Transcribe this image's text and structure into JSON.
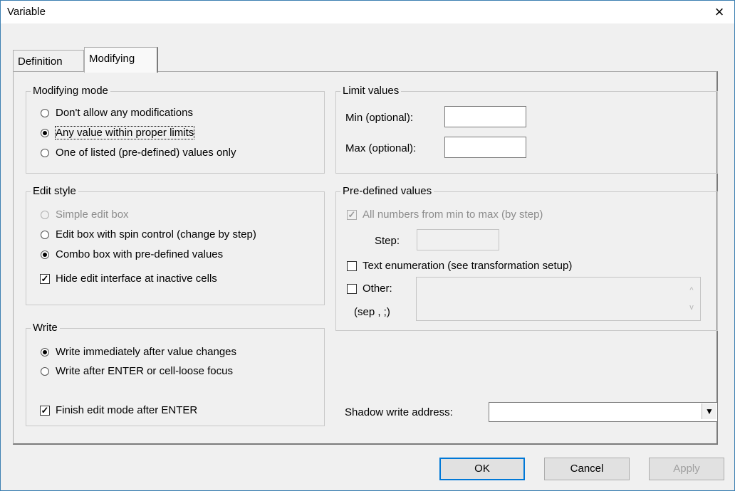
{
  "window": {
    "title": "Variable",
    "close_glyph": "×"
  },
  "tabs": [
    {
      "label": "Definition",
      "active": false
    },
    {
      "label": "Modifying",
      "active": true
    }
  ],
  "modifying_mode": {
    "title": "Modifying mode",
    "options": [
      {
        "label": "Don't allow any modifications",
        "checked": false
      },
      {
        "label": "Any value within proper limits",
        "checked": true
      },
      {
        "label": "One of listed (pre-defined) values only",
        "checked": false
      }
    ]
  },
  "limit_values": {
    "title": "Limit values",
    "min_label": "Min (optional):",
    "max_label": "Max (optional):",
    "min_value": "",
    "max_value": ""
  },
  "edit_style": {
    "title": "Edit style",
    "options": [
      {
        "label": "Simple edit box",
        "checked": false,
        "disabled": true
      },
      {
        "label": "Edit box with spin control (change by step)",
        "checked": false
      },
      {
        "label": "Combo box with pre-defined values",
        "checked": true
      }
    ],
    "hide_label": "Hide edit interface at inactive cells",
    "hide_checked": true
  },
  "predefined": {
    "title": "Pre-defined values",
    "all_numbers_label": "All numbers from min to max (by step)",
    "all_numbers_checked": true,
    "step_label": "Step:",
    "step_value": "",
    "text_enum_label": "Text enumeration (see transformation setup)",
    "text_enum_checked": false,
    "other_label": "Other:",
    "other_sep_label": "(sep , ;)",
    "other_checked": false,
    "other_value": ""
  },
  "write": {
    "title": "Write",
    "options": [
      {
        "label": "Write immediately after value changes",
        "checked": true
      },
      {
        "label": "Write after ENTER or cell-loose focus",
        "checked": false
      }
    ],
    "finish_label": "Finish edit mode after ENTER",
    "finish_checked": true
  },
  "shadow": {
    "label": "Shadow write address:",
    "value": ""
  },
  "buttons": {
    "ok": "OK",
    "cancel": "Cancel",
    "apply": "Apply"
  },
  "icons": {
    "close": "close-icon",
    "dropdown": "chevron-down-icon"
  }
}
